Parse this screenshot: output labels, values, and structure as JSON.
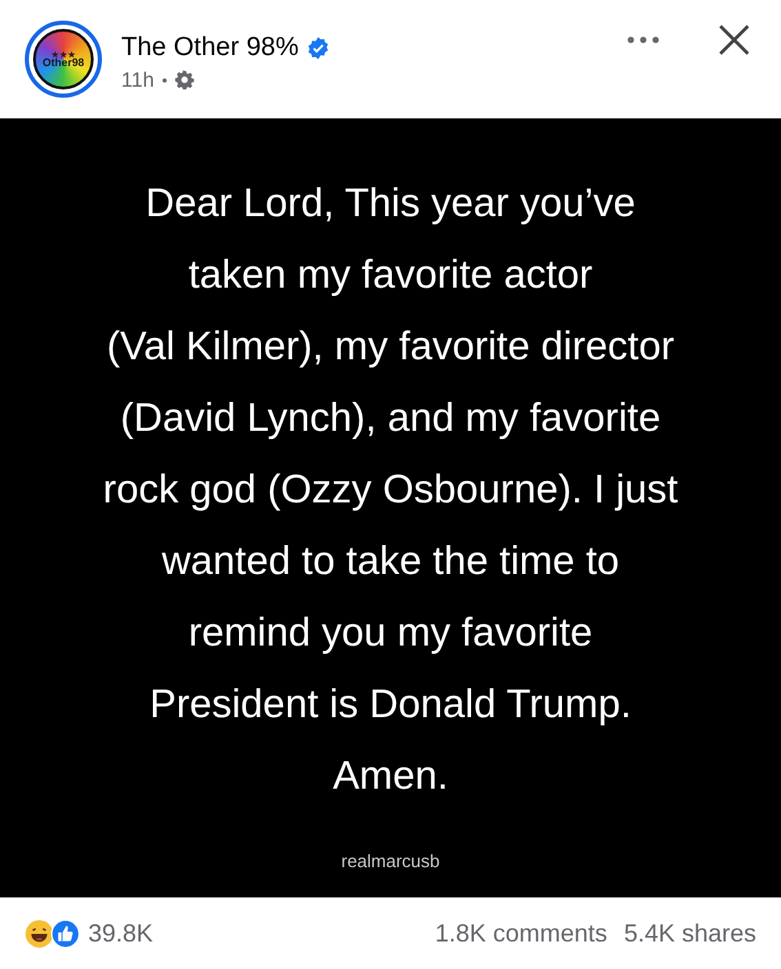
{
  "header": {
    "avatar_label": "Other98",
    "page_name": "The Other 98%",
    "verified": true,
    "time": "11h"
  },
  "post": {
    "lines": [
      "Dear Lord, This year you’ve",
      "taken my favorite actor",
      "(Val Kilmer), my favorite director",
      "(David Lynch), and my favorite",
      "rock god (Ozzy Osbourne). I just",
      "wanted to take the time to",
      "remind you my favorite",
      "President is Donald Trump.",
      "Amen."
    ],
    "credit": "realmarcusb"
  },
  "footer": {
    "reactions": "39.8K",
    "comments": "1.8K comments",
    "shares": "5.4K shares"
  }
}
